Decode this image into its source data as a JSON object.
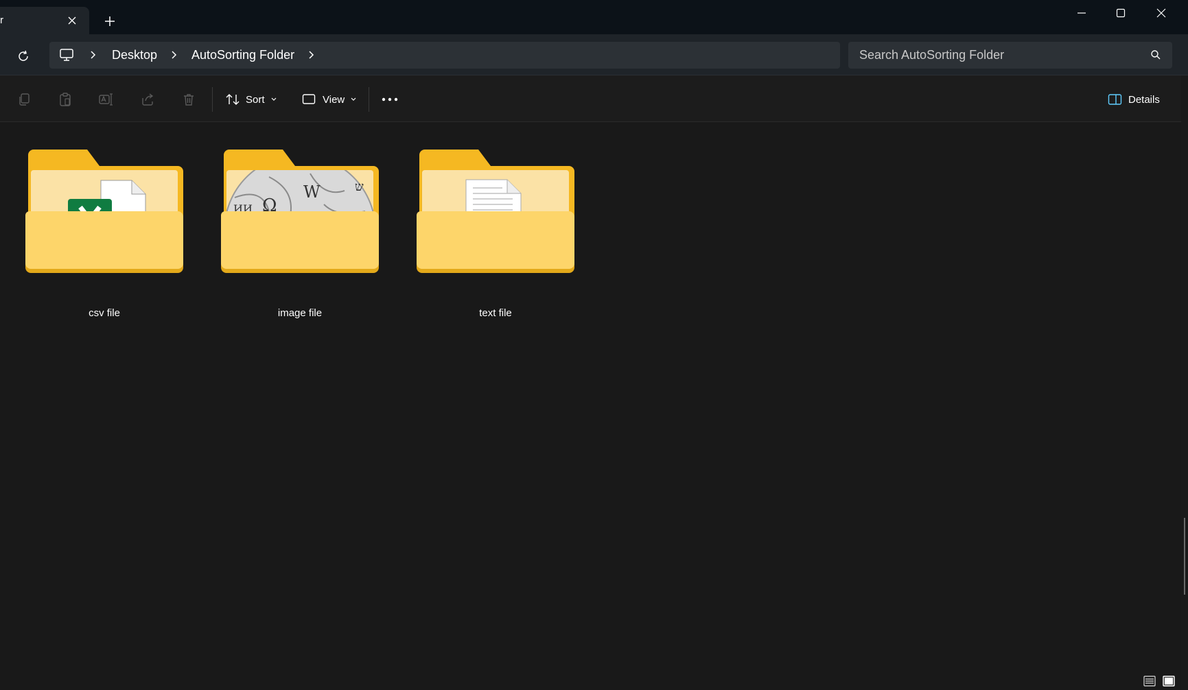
{
  "window": {
    "tab_title": "r",
    "minimize_label": "",
    "maximize_label": "",
    "close_label": ""
  },
  "address": {
    "breadcrumbs": [
      "Desktop",
      "AutoSorting Folder"
    ],
    "search_placeholder": "Search AutoSorting Folder"
  },
  "toolbar": {
    "sort_label": "Sort",
    "view_label": "View",
    "details_label": "Details"
  },
  "folders": [
    {
      "name": "csv file",
      "preview": "excel-icon"
    },
    {
      "name": "image file",
      "preview": "wikipedia-globe-icon"
    },
    {
      "name": "text file",
      "preview": "text-document-icon"
    }
  ],
  "colors": {
    "titlebar": "#0c1218",
    "addressbar": "#1f2429",
    "content_bg": "#191919",
    "folder_yellow": "#f7c948",
    "accent": "#60cdff"
  }
}
